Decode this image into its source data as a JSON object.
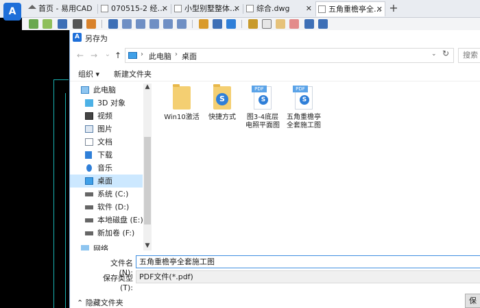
{
  "app": {
    "logo": "A",
    "tabs": [
      {
        "label": "首页 - 易用CAD",
        "active": false,
        "kind": "home"
      },
      {
        "label": "070515-2 经…",
        "active": false,
        "kind": "drawing"
      },
      {
        "label": "小型别墅整体…",
        "active": false,
        "kind": "drawing"
      },
      {
        "label": "综合.dwg",
        "active": false,
        "kind": "drawing"
      },
      {
        "label": "五角重檐亭全…",
        "active": true,
        "kind": "drawing"
      }
    ],
    "close_glyph": "✕",
    "add_tab_glyph": "+"
  },
  "toolbar": {
    "icons": [
      "layer-icon",
      "palm-icon",
      "save-icon",
      "print-icon",
      "export-icon",
      "pan-icon",
      "zoom-realtime-icon",
      "zoom-window-icon",
      "zoom-in-icon",
      "zoom-out-icon",
      "zoom-all-icon",
      "match-props-icon",
      "3d-view-icon",
      "cube-icon",
      "line-icon",
      "rectangle-icon",
      "text-icon",
      "erase-icon",
      "undo-icon",
      "redo-icon"
    ]
  },
  "dialog": {
    "title": "另存为",
    "logo": "A",
    "nav": {
      "back": "←",
      "forward": "→",
      "dropdown": "⌄",
      "up": "↑"
    },
    "address": {
      "crumbs": [
        "此电脑",
        "桌面"
      ],
      "sep": "›",
      "dropdown": "⌄",
      "refresh": "↻"
    },
    "search_placeholder": "搜索",
    "commands": {
      "organize": "组织 ▾",
      "new_folder": "新建文件夹"
    },
    "tree": [
      {
        "label": "此电脑",
        "icon": "computer-icon",
        "indent": 1,
        "selected": false
      },
      {
        "label": "3D 对象",
        "icon": "3d-objects-icon",
        "indent": 2,
        "selected": false
      },
      {
        "label": "视频",
        "icon": "video-icon",
        "indent": 2,
        "selected": false
      },
      {
        "label": "图片",
        "icon": "pictures-icon",
        "indent": 2,
        "selected": false
      },
      {
        "label": "文档",
        "icon": "documents-icon",
        "indent": 2,
        "selected": false
      },
      {
        "label": "下载",
        "icon": "download-icon",
        "indent": 2,
        "selected": false
      },
      {
        "label": "音乐",
        "icon": "music-icon",
        "indent": 2,
        "selected": false
      },
      {
        "label": "桌面",
        "icon": "desktop-icon",
        "indent": 2,
        "selected": true
      },
      {
        "label": "系统 (C:)",
        "icon": "system-drive-icon",
        "indent": 2,
        "selected": false
      },
      {
        "label": "软件 (D:)",
        "icon": "drive-icon",
        "indent": 2,
        "selected": false
      },
      {
        "label": "本地磁盘 (E:)",
        "icon": "drive-icon",
        "indent": 2,
        "selected": false
      },
      {
        "label": "新加卷 (F:)",
        "icon": "drive-icon",
        "indent": 2,
        "selected": false
      },
      {
        "label": "网络",
        "icon": "network-icon",
        "indent": 1,
        "selected": false
      }
    ],
    "files": [
      {
        "name": "Win10激活",
        "type": "folder"
      },
      {
        "name": "快捷方式",
        "type": "folder-shortcut"
      },
      {
        "name": "图3-4底层电照平面图",
        "type": "pdf"
      },
      {
        "name": "五角重檐亭全套施工图",
        "type": "pdf"
      }
    ],
    "pdf_tag": "PDF",
    "pdf_mark": "S",
    "filename_label": "文件名(N):",
    "filename_value": "五角重檐亭全套施工图",
    "filetype_label": "保存类型(T):",
    "filetype_value": "PDF文件(*.pdf)",
    "hide_folders": "隐藏文件夹",
    "save_button": "保存(S)",
    "scroll_up": "▲",
    "scroll_down": "▼"
  }
}
